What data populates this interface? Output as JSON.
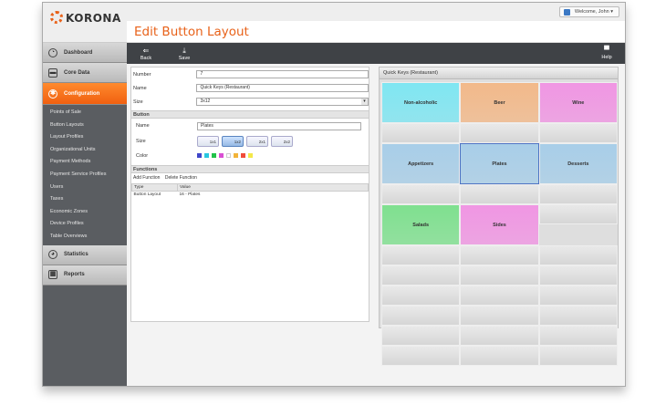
{
  "app": {
    "logo_text": "KORONA"
  },
  "sidebar": {
    "main_items": [
      {
        "label": "Dashboard"
      },
      {
        "label": "Core Data"
      },
      {
        "label": "Configuration"
      }
    ],
    "sub_items": [
      "Points of Sale",
      "Button Layouts",
      "Layout Profiles",
      "Organizational Units",
      "Payment Methods",
      "Payment Service Profiles",
      "Users",
      "Taxes",
      "Economic Zones",
      "Device Profiles",
      "Table Overviews"
    ],
    "bottom_items": [
      {
        "label": "Statistics"
      },
      {
        "label": "Reports"
      }
    ]
  },
  "header": {
    "welcome": "Welcome, John"
  },
  "page": {
    "title": "Edit Button Layout"
  },
  "toolbar": {
    "back": "Back",
    "save": "Save",
    "help": "Help"
  },
  "form": {
    "number_label": "Number",
    "number_value": "7",
    "name_label": "Name",
    "name_value": "Quick Keys (Restaurant)",
    "size_label": "Size",
    "size_value": "3x12",
    "button_section": "Button",
    "button_name_label": "Name",
    "button_name_value": "Plates",
    "button_size_label": "Size",
    "sizes": [
      "1x1",
      "1x2",
      "2x1",
      "2x2"
    ],
    "selected_size": "1x2",
    "color_label": "Color",
    "colors": [
      "#3f46c9",
      "#29c7e0",
      "#22c24a",
      "#d94fd3",
      "#ffffff",
      "#f2b43a",
      "#f04d3a",
      "#f3e84a"
    ],
    "functions_section": "Functions",
    "add_function": "Add Function",
    "delete_function": "Delete Function",
    "table_headers": [
      "Type",
      "Value"
    ],
    "table_rows": [
      [
        "Button Layout",
        "16 - Plates"
      ]
    ]
  },
  "quick_keys": {
    "title": "Quick Keys (Restaurant)",
    "colors": {
      "non_alcoholic": "#7fe6f2",
      "beer": "#f2b98a",
      "wine": "#f096e3",
      "appetizers": "#a8cee8",
      "plates": "#a8cee8",
      "desserts": "#a8cee8",
      "salads": "#7fe08f",
      "sides": "#f096e3"
    },
    "row1": [
      "Non-alcoholic",
      "Beer",
      "Wine"
    ],
    "row2": [
      "Appetizers",
      "Plates",
      "Desserts"
    ],
    "row3": [
      "Salads",
      "Sides"
    ]
  }
}
